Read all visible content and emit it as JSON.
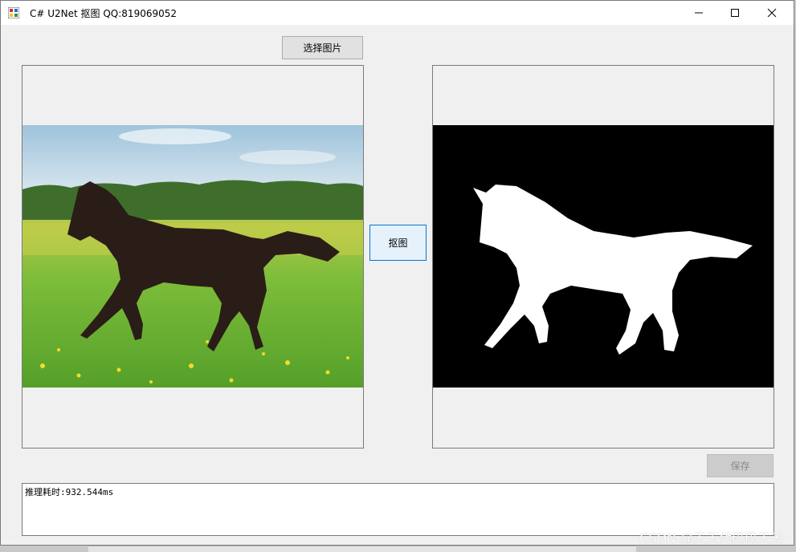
{
  "window": {
    "title": "C# U2Net 抠图 QQ:819069052"
  },
  "buttons": {
    "select_image": "选择图片",
    "matting": "抠图",
    "save": "保存"
  },
  "output": {
    "text": "推理耗时:932.544ms"
  },
  "watermark": "CSDN @天天代码码天天",
  "colors": {
    "titlebar_bg": "#ffffff",
    "form_bg": "#f0f0f0",
    "matting_button_bg": "#e5f1fb",
    "matting_button_border": "#0078d7",
    "mask_bg": "#000000",
    "mask_fg": "#ffffff"
  },
  "icons": {
    "app": "app-icon",
    "minimize": "minimize-icon",
    "maximize": "maximize-icon",
    "close": "close-icon"
  }
}
